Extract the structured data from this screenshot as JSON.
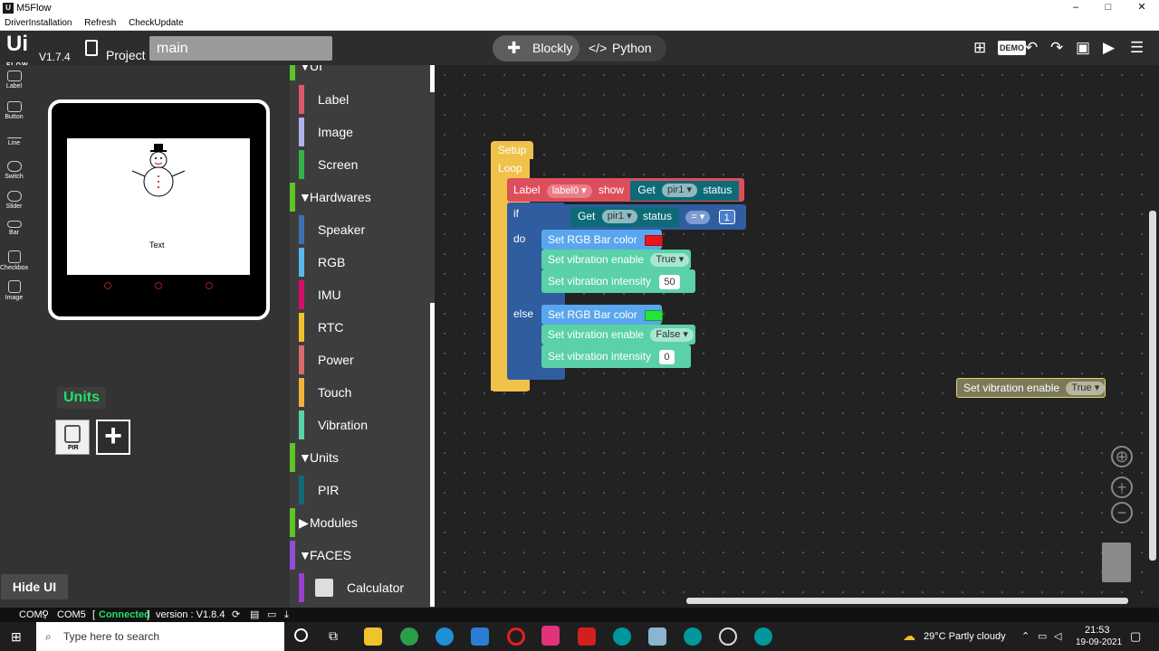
{
  "window": {
    "title": "M5Flow",
    "minimize": "–",
    "maximize": "□",
    "close": "✕"
  },
  "menu": [
    "DriverInstallation",
    "Refresh",
    "CheckUpdate"
  ],
  "app": {
    "logo": "Ui",
    "logo_sub": "FLOW",
    "version": "V1.7.4",
    "project_label": "Project",
    "project_name": "main",
    "tab_blockly": "Blockly",
    "tab_python": "Python"
  },
  "widgets": [
    "Label",
    "Button",
    "Line",
    "Switch",
    "Slider",
    "Bar",
    "Checkbox",
    "Image"
  ],
  "device": {
    "screen_text": "Text"
  },
  "units": {
    "label": "Units",
    "tile": "PIR",
    "add": "+"
  },
  "hide_ui": "Hide UI",
  "toolbox": {
    "ui_header": "UI",
    "ui_items": [
      "Label",
      "Image",
      "Screen"
    ],
    "hardwares": "Hardwares",
    "hardware_items": [
      "Speaker",
      "RGB",
      "IMU",
      "RTC",
      "Power",
      "Touch",
      "Vibration"
    ],
    "units": "Units",
    "unit_items": [
      "PIR"
    ],
    "modules": "Modules",
    "faces": "FACES",
    "faces_items": [
      "Calculator"
    ]
  },
  "blocks": {
    "setup": "Setup",
    "loop": "Loop",
    "label_kw": "Label",
    "label_var": "label0",
    "show_kw": "show",
    "get_kw": "Get",
    "pir_var": "pir1",
    "status_kw": "status",
    "if_kw": "if",
    "eq": "=",
    "cmp_val": "1",
    "do_kw": "do",
    "else_kw": "else",
    "rgb_kw": "Set RGB Bar color",
    "vib_enable_kw": "Set vibration enable",
    "vib_intensity_kw": "Set vibration intensity",
    "true_val": "True",
    "false_val": "False",
    "int_do": "50",
    "int_else": "0",
    "color_do": "#e8161b",
    "color_else": "#26e23c",
    "floating_kw": "Set vibration enable",
    "floating_val": "True"
  },
  "status": {
    "com": "COM:",
    "port": "COM5",
    "bracket_open": "[",
    "connected": "Connected",
    "bracket_close": "]",
    "version": "version : V1.8.4"
  },
  "taskbar": {
    "search": "Type here to search",
    "weather": "29°C  Partly cloudy",
    "time": "21:53",
    "date": "19-09-2021"
  }
}
